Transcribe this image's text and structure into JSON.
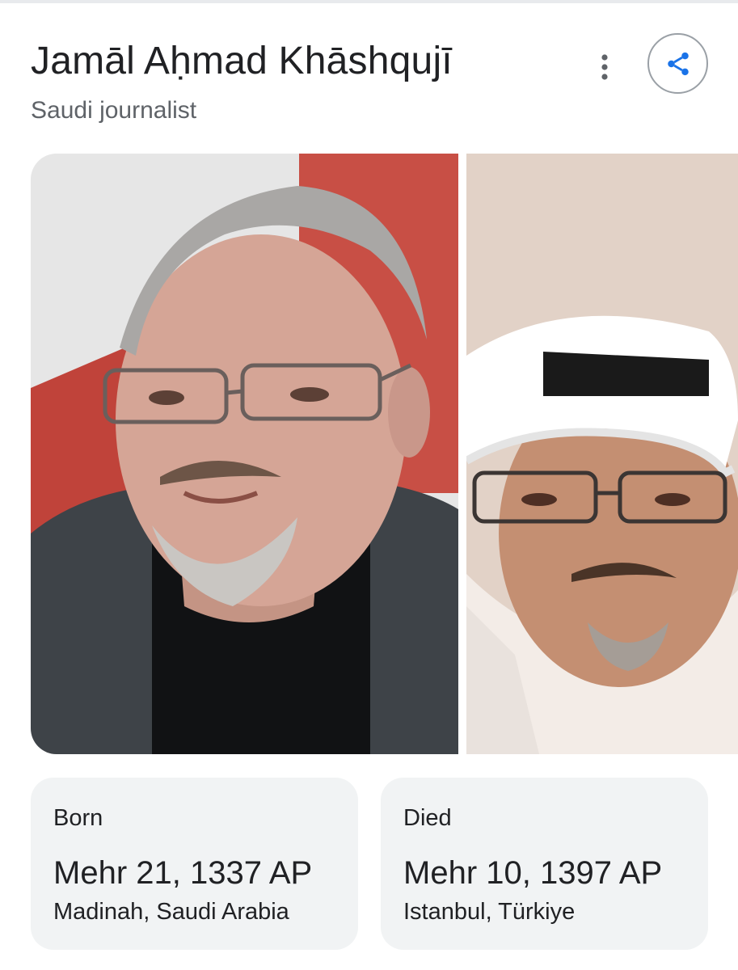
{
  "entity": {
    "name": "Jamāl Aḥmad Khāshqujī",
    "description": "Saudi journalist"
  },
  "actions": {
    "more_icon": "more-vert-icon",
    "share_icon": "share-icon"
  },
  "images": [
    {
      "subject": "photo-portrait-glasses-dark-jacket"
    },
    {
      "subject": "photo-portrait-white-headdress"
    }
  ],
  "facts": {
    "born": {
      "label": "Born",
      "date": "Mehr 21, 1337 AP",
      "place": "Madinah, Saudi Arabia"
    },
    "died": {
      "label": "Died",
      "date": "Mehr 10, 1397 AP",
      "place": "Istanbul, Türkiye"
    }
  },
  "colors": {
    "card_background": "#f1f3f4",
    "secondary_text": "#5f6368",
    "share_border": "#9aa0a6",
    "share_glyph": "#1a73e8"
  }
}
